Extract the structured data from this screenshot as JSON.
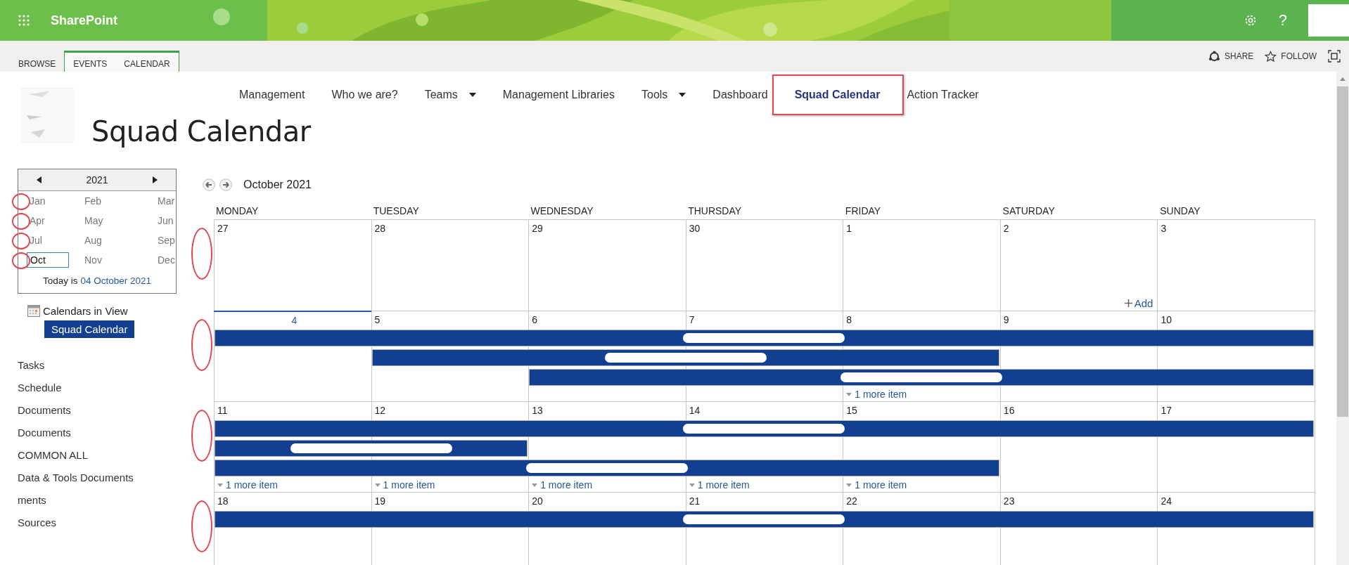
{
  "suite_bar": {
    "app_name": "SharePoint",
    "help": "?"
  },
  "ribbon": {
    "tabs": [
      {
        "label": "BROWSE",
        "selected": false,
        "kind": "plain"
      },
      {
        "label": "EVENTS",
        "selected": false,
        "kind": "contextual"
      },
      {
        "label": "CALENDAR",
        "selected": false,
        "kind": "contextual"
      }
    ],
    "actions": [
      {
        "label": "SHARE",
        "kind": "share"
      },
      {
        "label": "FOLLOW",
        "kind": "follow"
      }
    ]
  },
  "top_nav": [
    {
      "label": "Management",
      "selected": false,
      "dropdown": false
    },
    {
      "label": "Who we are?",
      "selected": false,
      "dropdown": false
    },
    {
      "label": "Teams",
      "selected": false,
      "dropdown": true
    },
    {
      "label": "Management Libraries",
      "selected": false,
      "dropdown": false
    },
    {
      "label": "Tools",
      "selected": false,
      "dropdown": true
    },
    {
      "label": "Dashboard",
      "selected": false,
      "dropdown": false
    },
    {
      "label": "Squad Calendar",
      "selected": true,
      "dropdown": false
    },
    {
      "label": "Action Tracker",
      "selected": false,
      "dropdown": false
    }
  ],
  "page_title": "Squad Calendar",
  "date_picker": {
    "year": "2021",
    "months": [
      {
        "label": "Jan",
        "selected": false
      },
      {
        "label": "Feb",
        "selected": false
      },
      {
        "label": "Mar",
        "selected": false
      },
      {
        "label": "Apr",
        "selected": false
      },
      {
        "label": "May",
        "selected": false
      },
      {
        "label": "Jun",
        "selected": false
      },
      {
        "label": "Jul",
        "selected": false
      },
      {
        "label": "Aug",
        "selected": false
      },
      {
        "label": "Sep",
        "selected": false
      },
      {
        "label": "Oct",
        "selected": true
      },
      {
        "label": "Nov",
        "selected": false
      },
      {
        "label": "Dec",
        "selected": false
      }
    ],
    "today_label": "Today is",
    "today_link": "04 October 2021"
  },
  "calendars_in_view": {
    "title": "Calendars in View",
    "calendars": [
      "Squad Calendar"
    ]
  },
  "quick_launch": [
    "Tasks",
    "Schedule",
    "Documents",
    "Documents",
    "COMMON ALL",
    "Data & Tools Documents",
    "ments",
    "Sources"
  ],
  "calendar": {
    "month": "October 2021",
    "weekdays": [
      "MONDAY",
      "TUESDAY",
      "WEDNESDAY",
      "THURSDAY",
      "FRIDAY",
      "SATURDAY",
      "SUNDAY"
    ],
    "weeks": [
      {
        "days": [
          {
            "date": "27",
            "today": false
          },
          {
            "date": "28",
            "today": false
          },
          {
            "date": "29",
            "today": false
          },
          {
            "date": "30",
            "today": false
          },
          {
            "date": "1",
            "today": false
          },
          {
            "date": "2",
            "today": false,
            "add": "Add"
          },
          {
            "date": "3",
            "today": false
          }
        ]
      },
      {
        "days": [
          {
            "date": "4",
            "today": true
          },
          {
            "date": "5",
            "today": false
          },
          {
            "date": "6",
            "today": false
          },
          {
            "date": "7",
            "today": false
          },
          {
            "date": "8",
            "today": false,
            "more": "1 more item"
          },
          {
            "date": "9",
            "today": false
          },
          {
            "date": "10",
            "today": false
          }
        ],
        "events": [
          {
            "days": [
              true,
              true,
              true,
              true,
              true,
              true,
              true
            ]
          },
          {
            "days": [
              false,
              true,
              true,
              true,
              true,
              false,
              false
            ]
          },
          {
            "days": [
              false,
              false,
              true,
              true,
              true,
              true,
              true
            ]
          }
        ]
      },
      {
        "days": [
          {
            "date": "11",
            "today": false,
            "more": "1 more item"
          },
          {
            "date": "12",
            "today": false,
            "more": "1 more item"
          },
          {
            "date": "13",
            "today": false,
            "more": "1 more item"
          },
          {
            "date": "14",
            "today": false,
            "more": "1 more item"
          },
          {
            "date": "15",
            "today": false,
            "more": "1 more item"
          },
          {
            "date": "16",
            "today": false
          },
          {
            "date": "17",
            "today": false
          }
        ],
        "events": [
          {
            "days": [
              true,
              true,
              true,
              true,
              true,
              true,
              true
            ]
          },
          {
            "days": [
              true,
              true,
              false,
              false,
              false,
              false,
              false
            ]
          },
          {
            "days": [
              true,
              true,
              true,
              true,
              true,
              false,
              false
            ]
          }
        ]
      },
      {
        "days": [
          {
            "date": "18",
            "today": false
          },
          {
            "date": "19",
            "today": false
          },
          {
            "date": "20",
            "today": false
          },
          {
            "date": "21",
            "today": false
          },
          {
            "date": "22",
            "today": false
          },
          {
            "date": "23",
            "today": false
          },
          {
            "date": "24",
            "today": false
          }
        ],
        "events": [
          {
            "days": [
              true,
              true,
              true,
              true,
              true,
              true,
              true
            ]
          }
        ]
      }
    ]
  }
}
